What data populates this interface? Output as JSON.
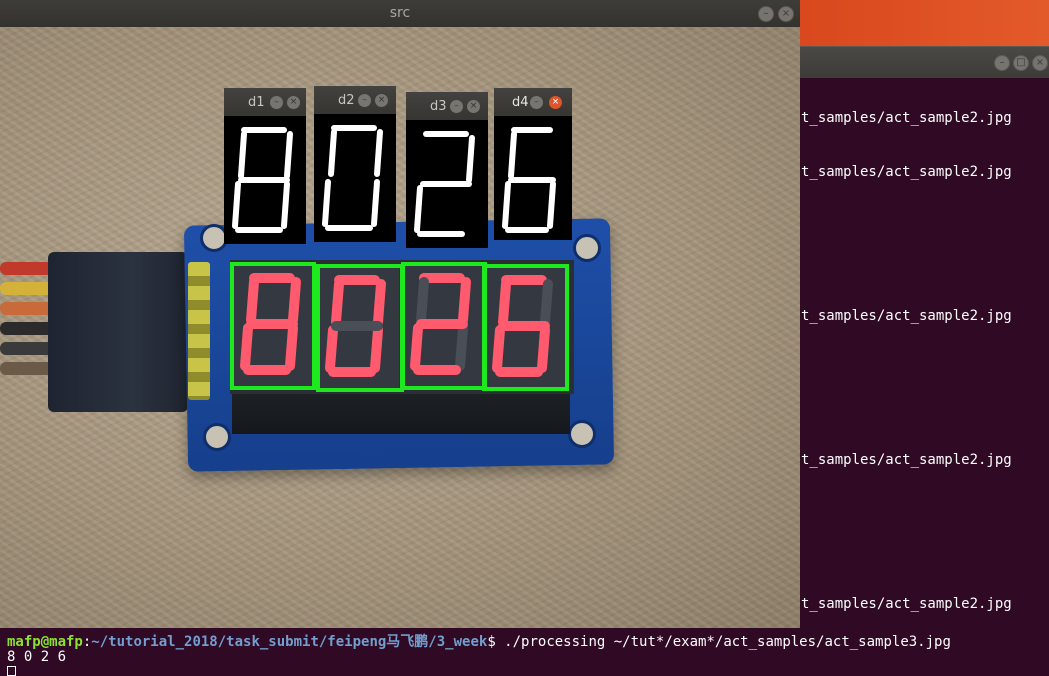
{
  "src_window": {
    "title": "src"
  },
  "digit_windows": [
    {
      "title": "d1",
      "digit": "8"
    },
    {
      "title": "d2",
      "digit": "0"
    },
    {
      "title": "d3",
      "digit": "2"
    },
    {
      "title": "d4",
      "digit": "6"
    }
  ],
  "background_terminal": {
    "lines": [
      "t_samples/act_sample2.jpg",
      "t_samples/act_sample2.jpg",
      "t_samples/act_sample2.jpg",
      "t_samples/act_sample2.jpg",
      "t_samples/act_sample2.jpg"
    ]
  },
  "bottom_terminal": {
    "user_host": "mafp@mafp",
    "path": "~/tutorial_2018/task_submit/feipeng马飞鹏/3_week",
    "prompt_symbol": "$",
    "command": " ./processing ~/tut*/exam*/act_samples/act_sample3.jpg",
    "output": "8 0 2 6"
  },
  "colors": {
    "terminal_bg": "#300a24",
    "detection_box": "#1ee81e",
    "led_segment": "#ff5a6e",
    "user_host": "#8ae234",
    "path": "#729fcf"
  }
}
